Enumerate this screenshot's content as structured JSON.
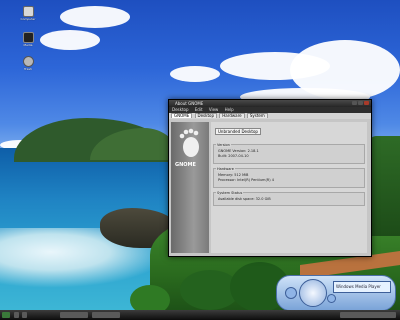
{
  "desktop_icons": [
    {
      "label": "Computer",
      "icon": "computer-icon"
    },
    {
      "label": "Media",
      "icon": "media-player-icon"
    },
    {
      "label": "Trash",
      "icon": "trash-icon"
    }
  ],
  "window": {
    "title": "About GNOME",
    "menu": [
      "Desktop",
      "Edit",
      "View",
      "Help"
    ],
    "tabs": [
      "GNOME",
      "Desktop",
      "Hardware",
      "System"
    ],
    "sidebar_logo_text": "GNOME",
    "heading": "Unbranded Desktop",
    "groups": [
      {
        "title": "Version",
        "lines": [
          "GNOME Version: 2.18.1",
          "Built: 2007-04-10"
        ]
      },
      {
        "title": "Hardware",
        "lines": [
          "Memory: 512 MiB",
          "Processor: Intel(R) Pentium(R) 4"
        ]
      },
      {
        "title": "System Status",
        "lines": [
          "Available disk space: 32.0 GiB"
        ]
      }
    ]
  },
  "gadget": {
    "display_text": "Windows Media Player"
  },
  "colors": {
    "window_bg": "#1b1b1b",
    "content_bg": "#d7d7d7",
    "taskbar_bg": "#0d0d0d"
  }
}
